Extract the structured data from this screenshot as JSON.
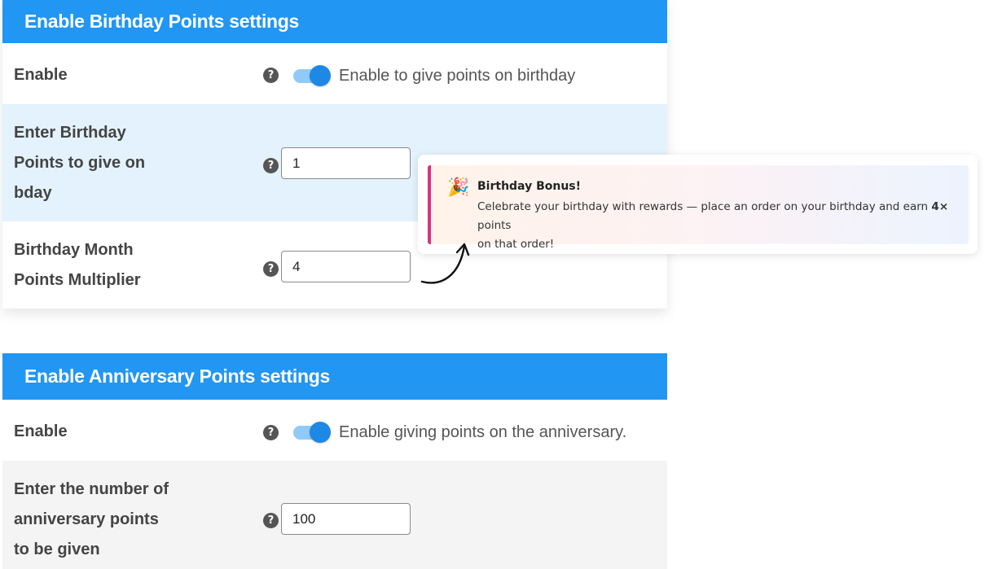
{
  "birthday_panel": {
    "header": "Enable Birthday Points settings",
    "enable_label": "Enable",
    "enable_toggle_on": true,
    "enable_description": "Enable to give points on birthday",
    "points_label_lines": [
      "Enter Birthday",
      "Points to give on",
      "bday"
    ],
    "points_value": "1",
    "multiplier_label_lines": [
      "Birthday Month",
      "Points Multiplier"
    ],
    "multiplier_value": "4"
  },
  "anniversary_panel": {
    "header": "Enable Anniversary Points settings",
    "enable_label": "Enable",
    "enable_toggle_on": true,
    "enable_description": "Enable giving points on the anniversary.",
    "points_label_lines": [
      "Enter the number of",
      "anniversary points",
      "to be given"
    ],
    "points_value": "100"
  },
  "help_icon_glyph": "?",
  "notice": {
    "icon": "party-popper-icon",
    "icon_glyph": "🎉",
    "title": "Birthday Bonus!",
    "body_before": "Celebrate your birthday with rewards — place an order on your birthday and earn ",
    "body_bold": "4×",
    "body_after": " points",
    "body_line2": "on that order!",
    "accent_color": "#d63384"
  },
  "colors": {
    "header_bg": "#2196f3",
    "toggle_knob": "#1e88e5",
    "toggle_track": "#90caf9",
    "highlight_row": "#e3f2fd"
  }
}
